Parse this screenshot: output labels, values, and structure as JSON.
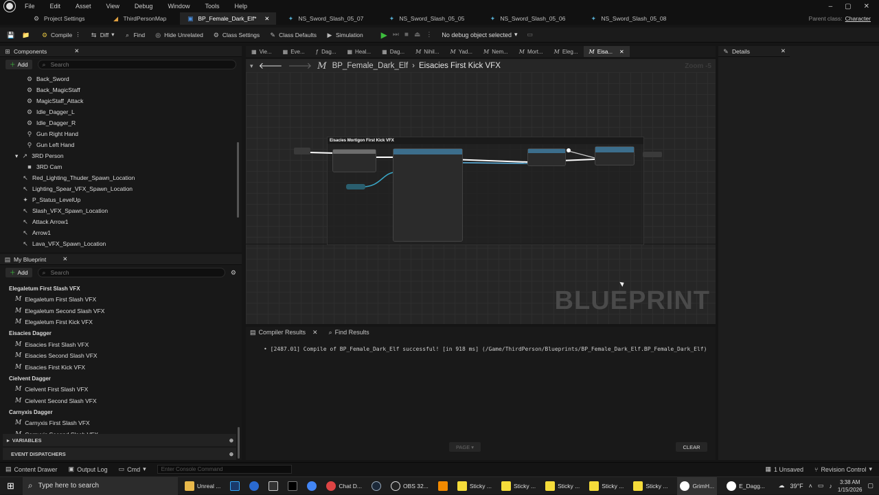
{
  "menu": {
    "items": [
      "File",
      "Edit",
      "Asset",
      "View",
      "Debug",
      "Window",
      "Tools",
      "Help"
    ]
  },
  "tabs": [
    "Project Settings",
    "ThirdPersonMap",
    "BP_Female_Dark_Elf*",
    "NS_Sword_Slash_05_07",
    "NS_Sword_Slash_05_05",
    "NS_Sword_Slash_05_06",
    "NS_Sword_Slash_05_08"
  ],
  "parent_class": {
    "label": "Parent class:",
    "value": "Character"
  },
  "toolbar": {
    "compile": "Compile",
    "diff": "Diff",
    "find": "Find",
    "hide_unrelated": "Hide Unrelated",
    "class_settings": "Class Settings",
    "class_defaults": "Class Defaults",
    "simulation": "Simulation",
    "debug_object": "No debug object selected"
  },
  "components": {
    "title": "Components",
    "add": "Add",
    "search_placeholder": "Search",
    "items": [
      "Back_Sword",
      "Back_MagicStaff",
      "MagicStaff_Attack",
      "Idle_Dagger_L",
      "Idle_Dagger_R",
      "Gun Right Hand",
      "Gun Left Hand",
      "3RD Person",
      "3RD Cam",
      "Red_Lighting_Thuder_Spawn_Location",
      "Lighting_Spear_VFX_Spawn_Location",
      "P_Status_LevelUp",
      "Slash_VFX_Spawn_Location",
      "Attack Arrow1",
      "Arrow1",
      "Lava_VFX_Spawn_Location"
    ]
  },
  "my_blueprint": {
    "title": "My Blueprint",
    "add": "Add",
    "search_placeholder": "Search",
    "groups": [
      {
        "name": "Elegaletum First Slash VFX",
        "items": [
          "Elegaletum First Slash VFX",
          "Elegaletum Second Slash VFX",
          "Elegaletum First Kick VFX"
        ]
      },
      {
        "name": "Eisacies Dagger",
        "items": [
          "Eisacies First Slash VFX",
          "Eisacies Second Slash VFX",
          "Eisacies First Kick VFX"
        ]
      },
      {
        "name": "Cielvent Dagger",
        "items": [
          "Cielvent First Slash VFX",
          "Cielvent Second Slash VFX"
        ]
      },
      {
        "name": "Carnyxis Dagger",
        "items": [
          "Carnyxis First Slash VFX",
          "Carnyxis Second Slash VFX"
        ]
      }
    ],
    "variables": "VARIABLES",
    "event_dispatchers": "EVENT DISPATCHERS"
  },
  "graph_tabs": [
    "Vie...",
    "Eve...",
    "Dag...",
    "Heal...",
    "Dag...",
    "Nihil...",
    "Yad...",
    "Nem...",
    "Mort...",
    "Eleg...",
    "Eisa..."
  ],
  "breadcrumb": {
    "root": "BP_Female_Dark_Elf",
    "current": "Eisacies First Kick VFX"
  },
  "zoom": "Zoom -5",
  "comment_title": "Eisacies Mortigon First Kick VFX",
  "watermark": "BLUEPRINT",
  "details": {
    "title": "Details"
  },
  "bottom_tabs": {
    "compiler": "Compiler Results",
    "find": "Find Results"
  },
  "compile_log": "• [2487.01] Compile of BP_Female_Dark_Elf successful! [in 918 ms] (/Game/ThirdPerson/Blueprints/BP_Female_Dark_Elf.BP_Female_Dark_Elf)",
  "page_btn": "PAGE",
  "clear_btn": "CLEAR",
  "status": {
    "content_drawer": "Content Drawer",
    "output_log": "Output Log",
    "cmd": "Cmd",
    "console_placeholder": "Enter Console Command",
    "unsaved": "1 Unsaved",
    "revision": "Revision Control"
  },
  "taskbar": {
    "search_placeholder": "Type here to search",
    "apps": [
      "Unreal ...",
      "",
      "",
      "",
      "",
      "Chat D...",
      "",
      "OBS 32...",
      "",
      "Sticky ...",
      "Sticky ...",
      "Sticky ...",
      "Sticky ...",
      "Sticky ...",
      "GrimH...",
      "E_Dagg..."
    ],
    "weather": "39°F",
    "time": "3:38 AM",
    "date": "1/15/2026"
  }
}
